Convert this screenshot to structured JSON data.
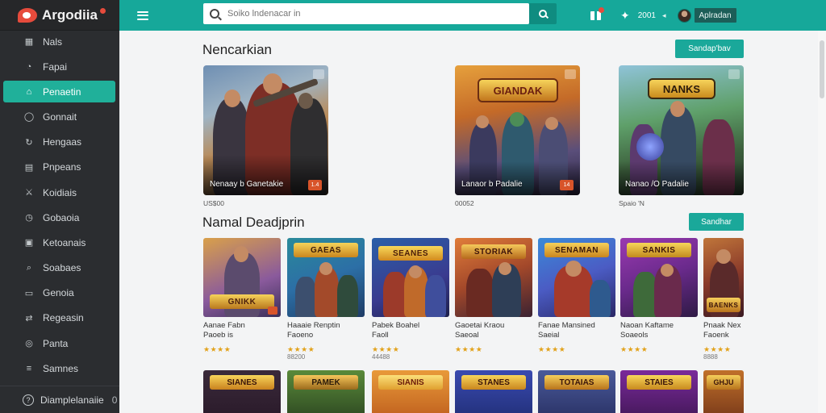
{
  "app": {
    "name": "Argodiia"
  },
  "sidebar": {
    "items": [
      {
        "label": "Nals",
        "icon": "grid-icon"
      },
      {
        "label": "Fapai",
        "icon": "compass-icon"
      },
      {
        "label": "Penaetin",
        "icon": "home-icon",
        "active": true
      },
      {
        "label": "Gonnait",
        "icon": "circle-icon"
      },
      {
        "label": "Hengaas",
        "icon": "refresh-icon"
      },
      {
        "label": "Pnpeans",
        "icon": "book-icon"
      },
      {
        "label": "Koidiais",
        "icon": "sword-icon"
      },
      {
        "label": "Gobaoia",
        "icon": "clock-icon"
      },
      {
        "label": "Ketoanais",
        "icon": "trophy-icon"
      },
      {
        "label": "Soabaes",
        "icon": "tag-icon"
      },
      {
        "label": "Genoia",
        "icon": "image-icon"
      },
      {
        "label": "Regeasin",
        "icon": "shuffle-icon"
      },
      {
        "label": "Panta",
        "icon": "star-icon"
      },
      {
        "label": "Samnes",
        "icon": "list-icon"
      }
    ],
    "footer": {
      "label": "Diamplelanaiie",
      "count": "0"
    }
  },
  "topbar": {
    "search_placeholder": "Soiko lndenacar in",
    "notif_count": "2001",
    "user_name": "Aplradan"
  },
  "section1": {
    "title": "Nencarkian",
    "button": "Sandap'bav",
    "items": [
      {
        "caption": "Nenaay b Ganetakie",
        "price": "US$00",
        "tag": "1.4"
      },
      {
        "caption": "Lanaor b Padalie",
        "price": "00052",
        "tag": "14",
        "logo": "GIANDAK"
      },
      {
        "caption": "Nanao /O Padalie",
        "price": "Spaio 'N",
        "tag": "",
        "logo": "NANKS"
      }
    ]
  },
  "section2": {
    "title": "Namal Deadjprin",
    "button": "Sandhar",
    "items": [
      {
        "title": "Aanae Fabn\nPaoeb is",
        "stars": "★★★★",
        "meta": "",
        "logo": "GNIKK"
      },
      {
        "title": "Haaaie Renptin\nFaoeno",
        "stars": "★★★★",
        "meta": "88200",
        "logo": "GAEAS"
      },
      {
        "title": "Pabek Boahel\nFaoll",
        "stars": "★★★★",
        "meta": "44488",
        "logo": "SEANES"
      },
      {
        "title": "Gaoetai Kraou\nSaeoal",
        "stars": "★★★★",
        "meta": "",
        "logo": "STORIAK"
      },
      {
        "title": "Fanae Mansined\nSaeial",
        "stars": "★★★★",
        "meta": "",
        "logo": "SENAMAN"
      },
      {
        "title": "Naoan Kaftame\nSoaeols",
        "stars": "★★★★",
        "meta": "",
        "logo": "SANKIS"
      },
      {
        "title": "Pnaak Nex\nFaoenk",
        "stars": "★★★★",
        "meta": "8888",
        "logo": "BAENKS"
      }
    ]
  },
  "section3": {
    "items": [
      {
        "logo": "SIANES"
      },
      {
        "logo": "PAMEK"
      },
      {
        "logo": "SIANIS"
      },
      {
        "logo": "STANES"
      },
      {
        "logo": "TOTAIAS"
      },
      {
        "logo": "STAIES"
      },
      {
        "logo": "GHJU"
      }
    ]
  },
  "colors": {
    "accent": "#16a89a",
    "sidebar": "#2b2d30",
    "active": "#20b09a",
    "badge": "#e64b3c"
  }
}
